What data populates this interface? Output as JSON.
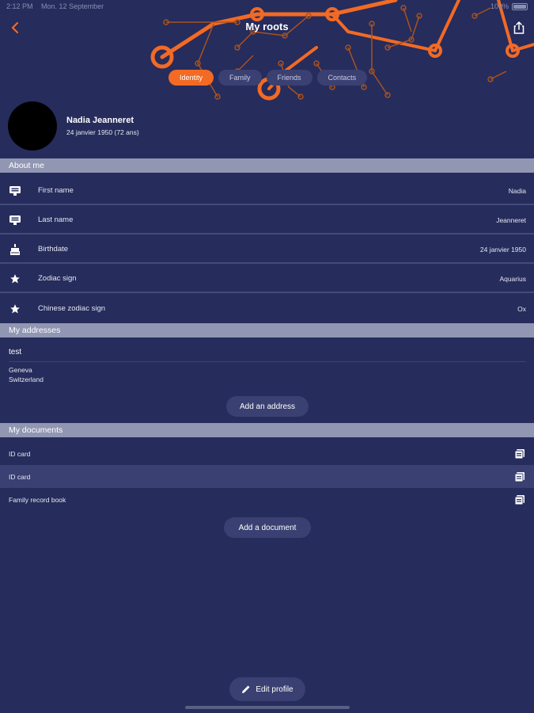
{
  "status_bar": {
    "time": "2:12 PM",
    "date": "Mon. 12 September",
    "battery": "100%"
  },
  "header": {
    "title": "My roots"
  },
  "tabs": [
    {
      "label": "Identity",
      "active": true
    },
    {
      "label": "Family",
      "active": false
    },
    {
      "label": "Friends",
      "active": false
    },
    {
      "label": "Contacts",
      "active": false
    }
  ],
  "profile": {
    "name": "Nadia Jeanneret",
    "birth": "24 janvier 1950 (72 ans)"
  },
  "about": {
    "header": "About me",
    "rows": [
      {
        "icon": "id-card-icon",
        "label": "First name",
        "value": "Nadia"
      },
      {
        "icon": "id-card-icon",
        "label": "Last name",
        "value": "Jeanneret"
      },
      {
        "icon": "cake-icon",
        "label": "Birthdate",
        "value": "24 janvier 1950"
      },
      {
        "icon": "star-icon",
        "label": "Zodiac sign",
        "value": "Aquarius"
      },
      {
        "icon": "star-icon",
        "label": "Chinese zodiac sign",
        "value": "Ox"
      }
    ]
  },
  "addresses": {
    "header": "My addresses",
    "items": [
      {
        "title": "test",
        "line1": "Geneva",
        "line2": "Switzerland"
      }
    ],
    "add_label": "Add an address"
  },
  "documents": {
    "header": "My documents",
    "items": [
      {
        "label": "ID card",
        "highlighted": false
      },
      {
        "label": "ID card",
        "highlighted": true
      },
      {
        "label": "Family record book",
        "highlighted": false
      }
    ],
    "add_label": "Add a document"
  },
  "edit_profile_label": "Edit profile",
  "colors": {
    "background": "#262c5c",
    "accent": "#f26a24",
    "section": "#9196b3",
    "pill": "#3a4072"
  }
}
